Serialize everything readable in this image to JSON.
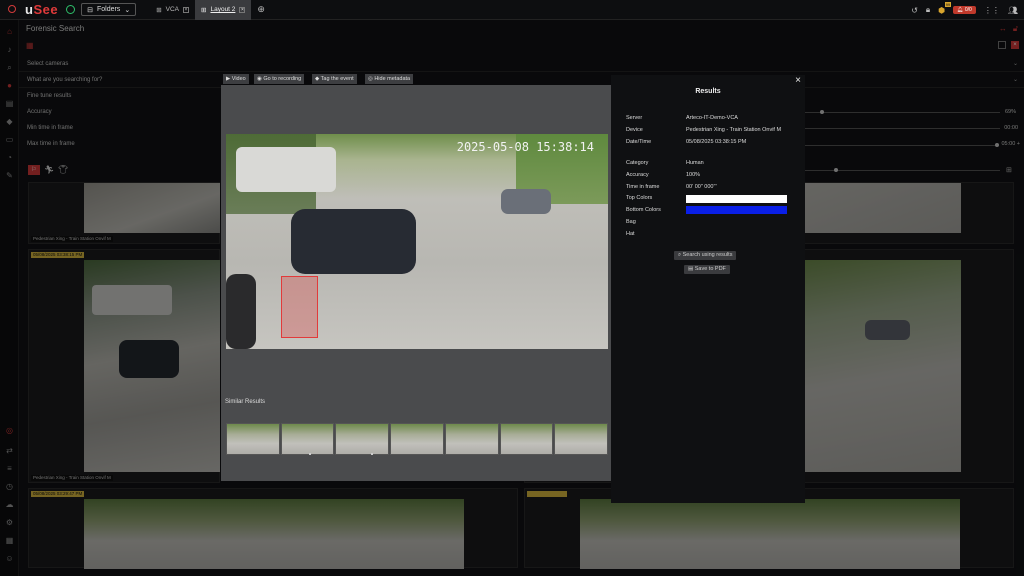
{
  "app": {
    "brand_a": "u",
    "brand_b": "See"
  },
  "toolbar": {
    "folders_label": "Folders",
    "tabs": [
      {
        "label": "VCA"
      },
      {
        "label": "Layout 2"
      }
    ],
    "badge_top": "99",
    "badge_bell": "0/0"
  },
  "page": {
    "title": "Forensic Search"
  },
  "filters": {
    "select_cameras": "Select cameras",
    "searching_for": "What are you searching for?",
    "fine_tune": "Fine tune results",
    "accuracy": "Accuracy",
    "min_time": "Min time in frame",
    "max_time": "Max time in frame",
    "accuracy_value": "69%",
    "min_value": "00:00",
    "max_value": "05:00 +"
  },
  "tiles": [
    {
      "tag": "Pedestrian Xing - Train Station Onvif M"
    },
    {
      "tag": "05/08/2025 03:38:15 PM"
    },
    {
      "tag": "Pedestrian Xing - Train Station Onvif M"
    },
    {
      "tag": "05/08/2025 03:29:47 PM"
    }
  ],
  "viewer": {
    "btn_video": "Video",
    "btn_goto": "Go to recording",
    "btn_tag": "Tag the event",
    "btn_hide": "Hide metadata",
    "osd": "2025-05-08 15:38:14",
    "similar": "Similar Results",
    "thumbs": [
      "",
      "",
      "",
      "",
      "",
      "",
      ""
    ]
  },
  "results": {
    "title": "Results",
    "close": "×",
    "rows": [
      {
        "k": "Server",
        "v": "Arteco-IT-Demo-VCA"
      },
      {
        "k": "Device",
        "v": "Pedestrian Xing - Train Station Onvif M"
      },
      {
        "k": "Date/Time",
        "v": "05/08/2025 03:38:15 PM"
      },
      {
        "k": "Category",
        "v": "Human"
      },
      {
        "k": "Accuracy",
        "v": "100%"
      },
      {
        "k": "Time in frame",
        "v": "00' 00\" 000'''"
      },
      {
        "k": "Top Colors",
        "v": ""
      },
      {
        "k": "Bottom Colors",
        "v": ""
      },
      {
        "k": "Bag",
        "v": ""
      },
      {
        "k": "Hat",
        "v": ""
      }
    ],
    "top_color": "#ffffff",
    "bottom_color": "#0a1fe8",
    "search_btn": "Search using results",
    "pdf_btn": "Save to PDF"
  },
  "colors": {
    "accent": "#d23a3a",
    "green": "#2ec06a"
  }
}
